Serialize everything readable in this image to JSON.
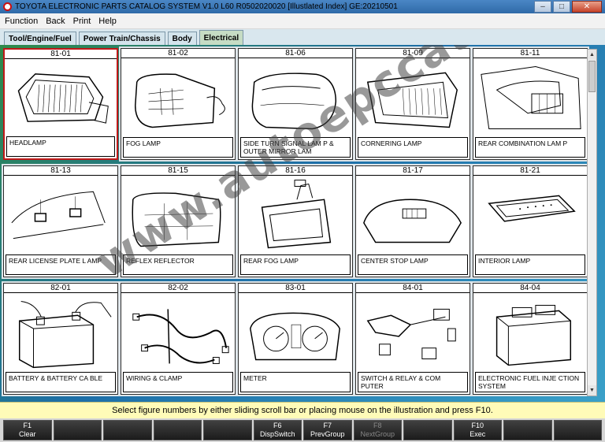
{
  "window": {
    "title": "TOYOTA ELECTRONIC PARTS CATALOG SYSTEM V1.0 L60 R0502020020 [Illustlated Index] GE:20210501",
    "minimize": "–",
    "maximize": "□",
    "close": "✕"
  },
  "menu": [
    "Function",
    "Back",
    "Print",
    "Help"
  ],
  "tabs": [
    {
      "label": "Tool/Engine/Fuel"
    },
    {
      "label": "Power Train/Chassis"
    },
    {
      "label": "Body"
    },
    {
      "label": "Electrical",
      "active": true
    }
  ],
  "figures": [
    {
      "number": "81-01",
      "label": "HEADLAMP",
      "icon": "headlamp",
      "selected": true
    },
    {
      "number": "81-02",
      "label": "FOG LAMP",
      "icon": "fog-lamp"
    },
    {
      "number": "81-06",
      "label": "SIDE TURN SIGNAL LAM P & OUTER MIRROR LAM",
      "icon": "side-turn-signal"
    },
    {
      "number": "81-09",
      "label": "CORNERING LAMP",
      "icon": "cornering-lamp"
    },
    {
      "number": "81-11",
      "label": "REAR COMBINATION LAM P",
      "icon": "rear-combination-lamp"
    },
    {
      "number": "81-13",
      "label": "REAR LICENSE PLATE L AMP",
      "icon": "license-plate-lamp"
    },
    {
      "number": "81-15",
      "label": "REFLEX REFLECTOR",
      "icon": "reflex-reflector"
    },
    {
      "number": "81-16",
      "label": "REAR FOG LAMP",
      "icon": "rear-fog-lamp"
    },
    {
      "number": "81-17",
      "label": "CENTER STOP LAMP",
      "icon": "center-stop-lamp"
    },
    {
      "number": "81-21",
      "label": "INTERIOR LAMP",
      "icon": "interior-lamp"
    },
    {
      "number": "82-01",
      "label": "BATTERY & BATTERY CA BLE",
      "icon": "battery"
    },
    {
      "number": "82-02",
      "label": "WIRING & CLAMP",
      "icon": "wiring-harness"
    },
    {
      "number": "83-01",
      "label": "METER",
      "icon": "meter-cluster"
    },
    {
      "number": "84-01",
      "label": "SWITCH & RELAY & COM PUTER",
      "icon": "switch-relay"
    },
    {
      "number": "84-04",
      "label": "ELECTRONIC FUEL INJE CTION SYSTEM",
      "icon": "ecu"
    }
  ],
  "watermark": "www.autoepccatalog.com",
  "status": "Select figure numbers by either sliding scroll bar or placing mouse on the illustration and press F10.",
  "fkeys": [
    {
      "key": "F1",
      "label": "Clear"
    },
    {
      "key": "",
      "label": ""
    },
    {
      "key": "",
      "label": ""
    },
    {
      "key": "",
      "label": ""
    },
    {
      "key": "",
      "label": ""
    },
    {
      "key": "F6",
      "label": "DispSwitch"
    },
    {
      "key": "F7",
      "label": "PrevGroup"
    },
    {
      "key": "F8",
      "label": "NextGroup",
      "disabled": true
    },
    {
      "key": "",
      "label": ""
    },
    {
      "key": "F10",
      "label": "Exec"
    },
    {
      "key": "",
      "label": ""
    },
    {
      "key": "",
      "label": ""
    }
  ]
}
